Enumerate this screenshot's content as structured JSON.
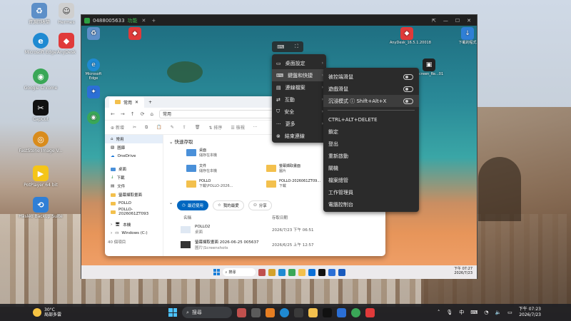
{
  "desktop_icons": [
    {
      "label": "資源回收筒",
      "icon": "recycle-bin-icon",
      "color": "#5d8fc8"
    },
    {
      "label": "Hermes",
      "icon": "hermes-icon",
      "color": "#cfcfcf"
    },
    {
      "label": "Microsoft Edge",
      "icon": "edge-icon",
      "color": "#1f8ad2"
    },
    {
      "label": "AnyDesk",
      "icon": "anydesk-icon",
      "color": "#e03a3a"
    },
    {
      "label": "Google Chrome",
      "icon": "chrome-icon",
      "color": "#3aa757"
    },
    {
      "label": "CapCut",
      "icon": "capcut-icon",
      "color": "#111111"
    },
    {
      "label": "FastStone Image V...",
      "icon": "faststone-icon",
      "color": "#d98c1d"
    },
    {
      "label": "PotPlayer 64 bit",
      "icon": "potplayer-icon",
      "color": "#f5c518"
    },
    {
      "label": "Hasleo Backup Suite",
      "icon": "hasleo-icon",
      "color": "#2f7fd6"
    }
  ],
  "remote_window": {
    "title": "0488005633",
    "status": "功能",
    "close_tab": "✕",
    "add_tab": "+",
    "controls": [
      "⇱",
      "—",
      "☐",
      "✕"
    ]
  },
  "remote_desktop_icons": [
    {
      "label": "",
      "icon": "recycle-bin-icon"
    },
    {
      "label": "",
      "icon": "anydesk-icon"
    },
    {
      "label": "AnyDesk_16.5.1.20018",
      "icon": "anydesk-icon"
    },
    {
      "label": "下載的程式",
      "icon": "downloads-icon"
    },
    {
      "label": "Microsoft Edge",
      "icon": "edge-icon"
    },
    {
      "label": "Screen_Re...01",
      "icon": "screen-recorder-icon"
    },
    {
      "label": "Microsoft Copilot",
      "icon": "copilot-icon"
    },
    {
      "label": "Google Chrome",
      "icon": "chrome-icon"
    }
  ],
  "explorer": {
    "tab_title": "常用",
    "tab_close": "✕",
    "add_tab": "+",
    "address": "常用",
    "new_label": "新增",
    "sort_label": "排序",
    "view_label": "檢視",
    "sidebar": [
      {
        "label": "常用",
        "selected": true
      },
      {
        "label": "圖庫",
        "selected": false
      },
      {
        "label": "OneDrive",
        "selected": false
      },
      {
        "label": "桌面",
        "selected": false
      },
      {
        "label": "下載",
        "selected": false
      },
      {
        "label": "文件",
        "selected": false
      },
      {
        "label": "螢幕擷取畫面",
        "selected": false
      },
      {
        "label": "POLLO",
        "selected": false
      },
      {
        "label": "POLLO-2026061ZT093",
        "selected": false
      },
      {
        "label": "本機",
        "selected": false
      },
      {
        "label": "Windows (C:)",
        "selected": false
      }
    ],
    "status_bar": "40 個項目",
    "quick_access_heading": "快速存取",
    "pins": [
      {
        "name": "桌面",
        "sub": "儲存在本機"
      },
      {
        "name": "文件",
        "sub": "儲存在本機"
      },
      {
        "name": "POLLO",
        "sub": "下載\\POLLO-2026..."
      },
      {
        "name": "螢幕擷取畫面",
        "sub": "圖片"
      },
      {
        "name": "POLLO-2026061ZT09...",
        "sub": "下載"
      }
    ],
    "filter_chips": [
      "最近使用",
      "我的最愛",
      "分享"
    ],
    "columns": [
      "名稱",
      "存取日期"
    ],
    "files": [
      {
        "name": "POLLO2",
        "sub": "桌面",
        "date": "2026/7/23 下午 06:51"
      },
      {
        "name": "螢幕擷取畫面 2026-06-25 005637",
        "sub": "圖片\\Screenshots",
        "date": "2026/6/25 上午 12:57"
      }
    ]
  },
  "remote_taskbar": {
    "search_placeholder": "搜尋",
    "clock_time": "下午 07:27",
    "clock_date": "2026/7/23"
  },
  "floating_toolbar": {
    "icons": [
      "keyboard-mode-icon",
      "fullscreen-icon"
    ]
  },
  "menu_main": [
    {
      "label": "桌面設定",
      "icon": "monitor-icon",
      "highlight": false
    },
    {
      "label": "鍵盤和快捷",
      "icon": "keyboard-icon",
      "highlight": true
    },
    {
      "label": "連線檔案",
      "icon": "file-icon",
      "highlight": false
    },
    {
      "label": "互動",
      "icon": "interact-icon",
      "highlight": false
    },
    {
      "label": "安全",
      "icon": "shield-icon",
      "highlight": false
    },
    {
      "label": "更多",
      "icon": "more-icon",
      "highlight": false
    },
    {
      "label": "結束連線",
      "icon": "exit-icon",
      "highlight": false
    }
  ],
  "menu_keyboard": {
    "toggles": [
      {
        "label": "被控端滑鼠",
        "on": false
      },
      {
        "label": "遊戲滑鼠",
        "on": false
      },
      {
        "label": "沉浸模式 ⓘ Shift+Alt+X",
        "on": false
      }
    ],
    "actions": [
      "CTRL+ALT+DELETE",
      "鎖定",
      "登出",
      "重新啟動",
      "關機",
      "檔案總管",
      "工作管理員",
      "電腦控制台"
    ]
  },
  "host_taskbar": {
    "weather_temp": "30°C",
    "weather_text": "局部多雲",
    "search_placeholder": "搜尋",
    "tray_lang": "中",
    "clock_time": "下午 07:23",
    "clock_date": "2026/7/23"
  }
}
